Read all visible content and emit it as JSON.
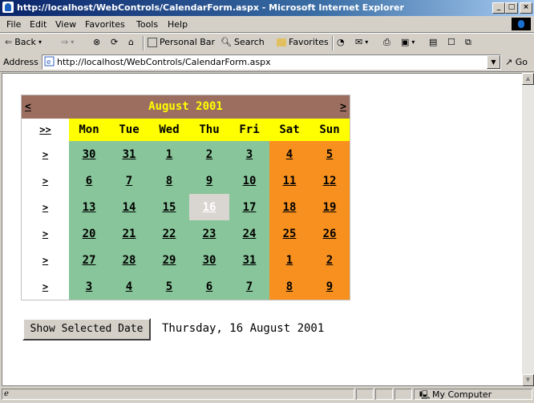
{
  "window": {
    "title": "http://localhost/WebControls/CalendarForm.aspx - Microsoft Internet Explorer",
    "buttons": {
      "minimize": "_",
      "restore": "□",
      "close": "×"
    }
  },
  "menu": [
    "File",
    "Edit",
    "View",
    "Favorites",
    "Tools",
    "Help"
  ],
  "toolbar": {
    "back": "Back",
    "forward": "⇒",
    "stop": "⊗",
    "refresh": "⟳",
    "home": "⌂",
    "personal_bar": "Personal Bar",
    "search": "Search",
    "favorites": "Favorites",
    "history": "◔",
    "mail": "✉",
    "print": "⎙",
    "edit": "▣",
    "discuss": "▤",
    "messenger": "☐",
    "extra": "⧉"
  },
  "address": {
    "label": "Address",
    "value": "http://localhost/WebControls/CalendarForm.aspx",
    "go": "Go"
  },
  "calendar": {
    "title": "August 2001",
    "prev": "<",
    "next": ">",
    "select_month": ">>",
    "select_week": ">",
    "day_headers": [
      "Mon",
      "Tue",
      "Wed",
      "Thu",
      "Fri",
      "Sat",
      "Sun"
    ],
    "weeks": [
      [
        "30",
        "31",
        "1",
        "2",
        "3",
        "4",
        "5"
      ],
      [
        "6",
        "7",
        "8",
        "9",
        "10",
        "11",
        "12"
      ],
      [
        "13",
        "14",
        "15",
        "16",
        "17",
        "18",
        "19"
      ],
      [
        "20",
        "21",
        "22",
        "23",
        "24",
        "25",
        "26"
      ],
      [
        "27",
        "28",
        "29",
        "30",
        "31",
        "1",
        "2"
      ],
      [
        "3",
        "4",
        "5",
        "6",
        "7",
        "8",
        "9"
      ]
    ],
    "selected_day": "16",
    "colors": {
      "header": "#9b6e60",
      "title": "#ffff00",
      "dayheader": "#ffff00",
      "weekday": "#88c59a",
      "weekend": "#f7901e",
      "selected": "#d9d6d2"
    }
  },
  "button": {
    "show_selected": "Show Selected Date"
  },
  "selected_date_text": "Thursday, 16 August 2001",
  "status": {
    "zone": "My Computer"
  }
}
